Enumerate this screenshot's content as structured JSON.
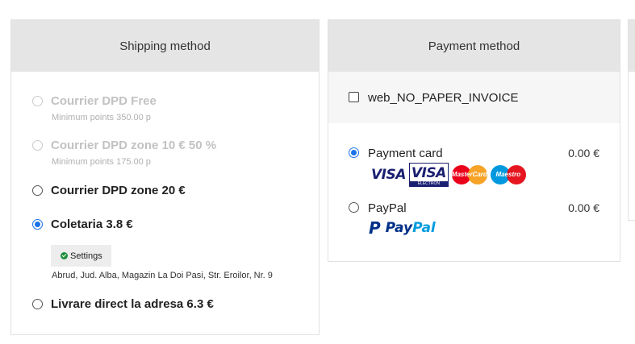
{
  "shipping": {
    "title": "Shipping method",
    "options": [
      {
        "label": "Courrier DPD Free",
        "sub": "Minimum points 350.00 p",
        "disabled": true,
        "selected": false
      },
      {
        "label": "Courrier DPD zone 10 € 50 %",
        "sub": "Minimum points 175.00 p",
        "disabled": true,
        "selected": false
      },
      {
        "label": "Courrier DPD zone 20 €",
        "disabled": false,
        "selected": false
      },
      {
        "label": "Coletaria 3.8 €",
        "disabled": false,
        "selected": true
      },
      {
        "label": "Livrare direct la adresa 6.3 €",
        "disabled": false,
        "selected": false
      }
    ],
    "settings_label": "Settings",
    "address": "Abrud, Jud. Alba, Magazin La Doi Pasi, Str. Eroilor, Nr. 9"
  },
  "payment": {
    "title": "Payment method",
    "checkbox_label": "web_NO_PAPER_INVOICE",
    "methods": [
      {
        "label": "Payment card",
        "price": "0.00 €",
        "selected": true
      },
      {
        "label": "PayPal",
        "price": "0.00 €",
        "selected": false
      }
    ],
    "card_logos": {
      "visa": "VISA",
      "visa_electron": "VISA",
      "electron": "ELECTRON",
      "mastercard": "MasterCard",
      "maestro": "Maestro"
    },
    "paypal_logo": {
      "part1": "Pay",
      "part2": "Pal"
    }
  },
  "colors": {
    "accent": "#1a73e8",
    "header_bg": "#e5e5e5",
    "check_green": "#1e8e3e"
  }
}
